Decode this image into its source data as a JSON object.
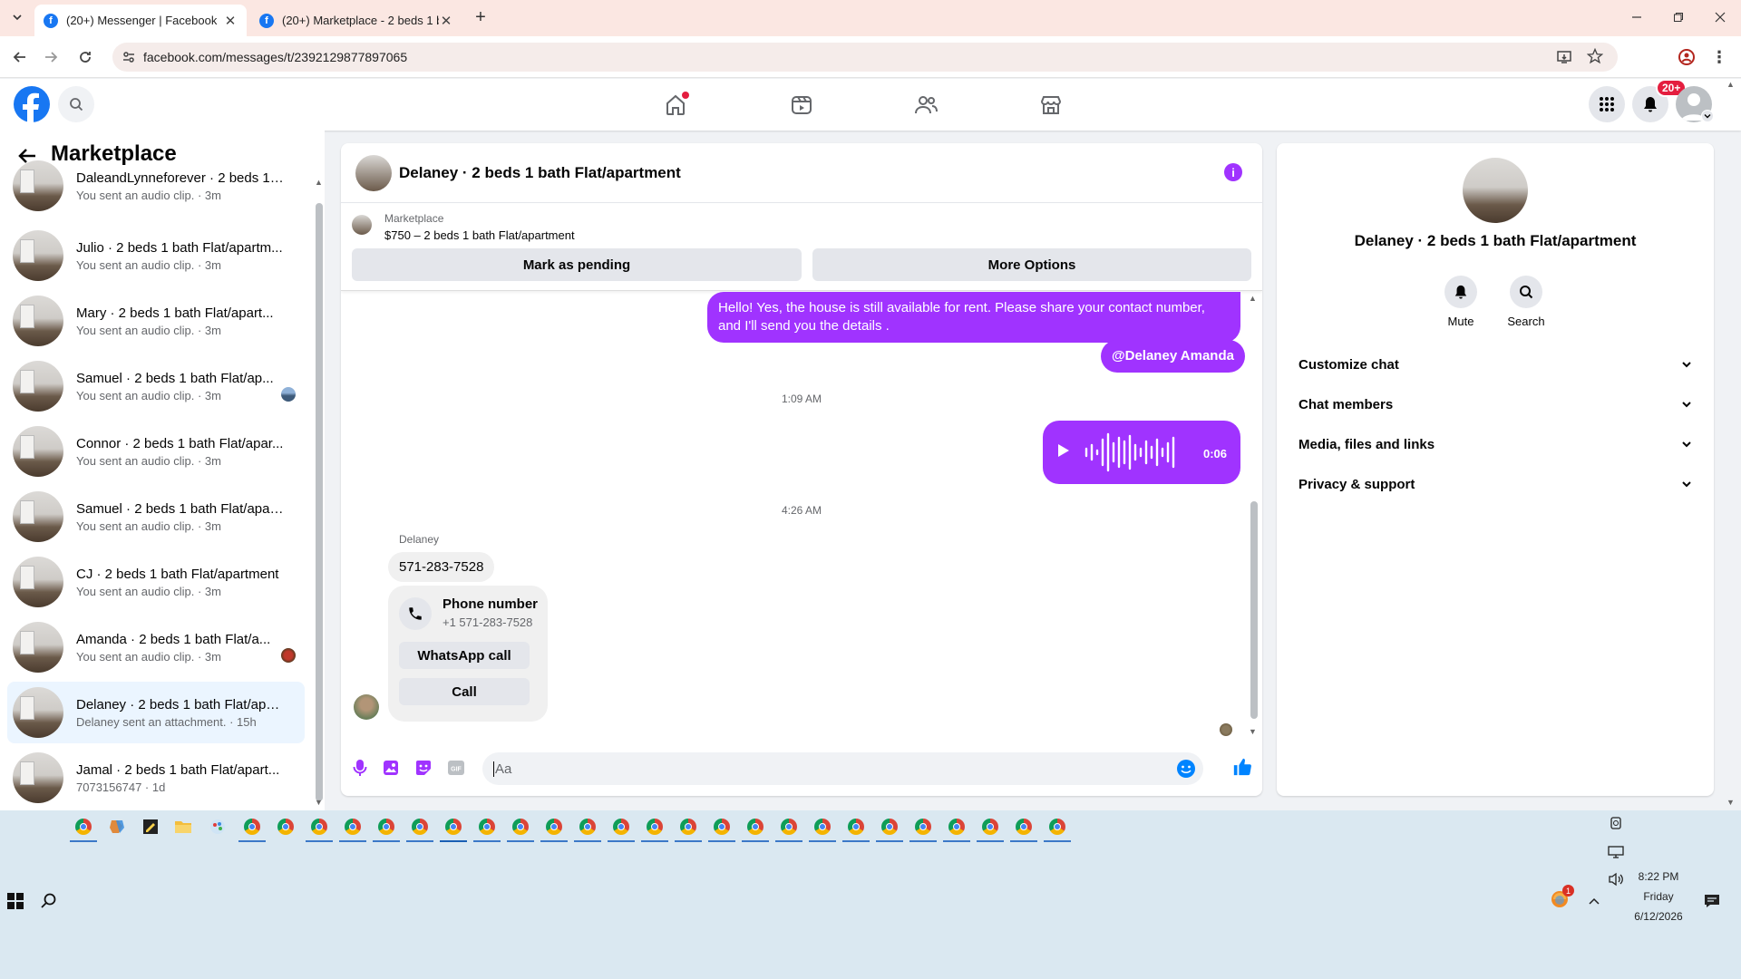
{
  "browser": {
    "tabs": [
      {
        "title": "(20+) Messenger | Facebook",
        "active": true
      },
      {
        "title": "(20+) Marketplace - 2 beds 1 b",
        "active": false
      }
    ],
    "url": "facebook.com/messages/t/2392129877897065"
  },
  "header": {
    "notification_badge": "20+",
    "nav_icons": [
      "home-icon",
      "video-icon",
      "friends-icon",
      "marketplace-icon"
    ]
  },
  "sidebar": {
    "title": "Marketplace",
    "conversations": [
      {
        "name": "DaleandLynneforever · 2 beds 1 ...",
        "preview": "You sent an audio clip. · 3m"
      },
      {
        "name": "Julio · 2 beds 1 bath Flat/apartm...",
        "preview": "You sent an audio clip. · 3m"
      },
      {
        "name": "Mary · 2 beds 1 bath Flat/apart...",
        "preview": "You sent an audio clip. · 3m"
      },
      {
        "name": "Samuel · 2 beds 1 bath Flat/ap...",
        "preview": "You sent an audio clip. · 3m"
      },
      {
        "name": "Connor · 2 beds 1 bath Flat/apar...",
        "preview": "You sent an audio clip. · 3m"
      },
      {
        "name": "Samuel · 2 beds 1 bath Flat/apar...",
        "preview": "You sent an audio clip. · 3m"
      },
      {
        "name": "CJ · 2 beds 1 bath Flat/apartment",
        "preview": "You sent an audio clip. · 3m"
      },
      {
        "name": "Amanda · 2 beds 1 bath Flat/a...",
        "preview": "You sent an audio clip. · 3m"
      },
      {
        "name": "Delaney · 2 beds 1 bath Flat/apa...",
        "preview": "Delaney sent an attachment. · 15h"
      },
      {
        "name": "Jamal · 2 beds 1 bath Flat/apart...",
        "preview": "7073156747 · 1d"
      }
    ]
  },
  "chat": {
    "title": "Delaney · 2 beds 1 bath Flat/apartment",
    "listing_label": "Marketplace",
    "listing_price_title": "$750 – 2 beds 1 bath Flat/apartment",
    "mark_pending": "Mark as pending",
    "more_options": "More Options",
    "msg_out_1": "Hello! Yes, the house is still available for rent. Please share your contact number, and I'll send you the details .",
    "msg_out_mention": "@Delaney Amanda",
    "time_1": "1:09 AM",
    "audio_duration": "0:06",
    "time_2": "4:26 AM",
    "sender": "Delaney",
    "msg_in_phone": "571-283-7528",
    "phone_card_title": "Phone number",
    "phone_card_number": "+1 571-283-7528",
    "whatsapp_call": "WhatsApp call",
    "call": "Call",
    "composer_placeholder": "Aa"
  },
  "details": {
    "name": "Delaney · 2 beds 1 bath Flat/apartment",
    "mute": "Mute",
    "search": "Search",
    "sections": [
      "Customize chat",
      "Chat members",
      "Media, files and links",
      "Privacy & support"
    ]
  },
  "taskbar": {
    "time": "8:22 PM",
    "day": "Friday",
    "date": "6/12/2026",
    "notif_count": "1"
  },
  "colors": {
    "accent": "#a033ff",
    "facebook_blue": "#1877f2"
  }
}
